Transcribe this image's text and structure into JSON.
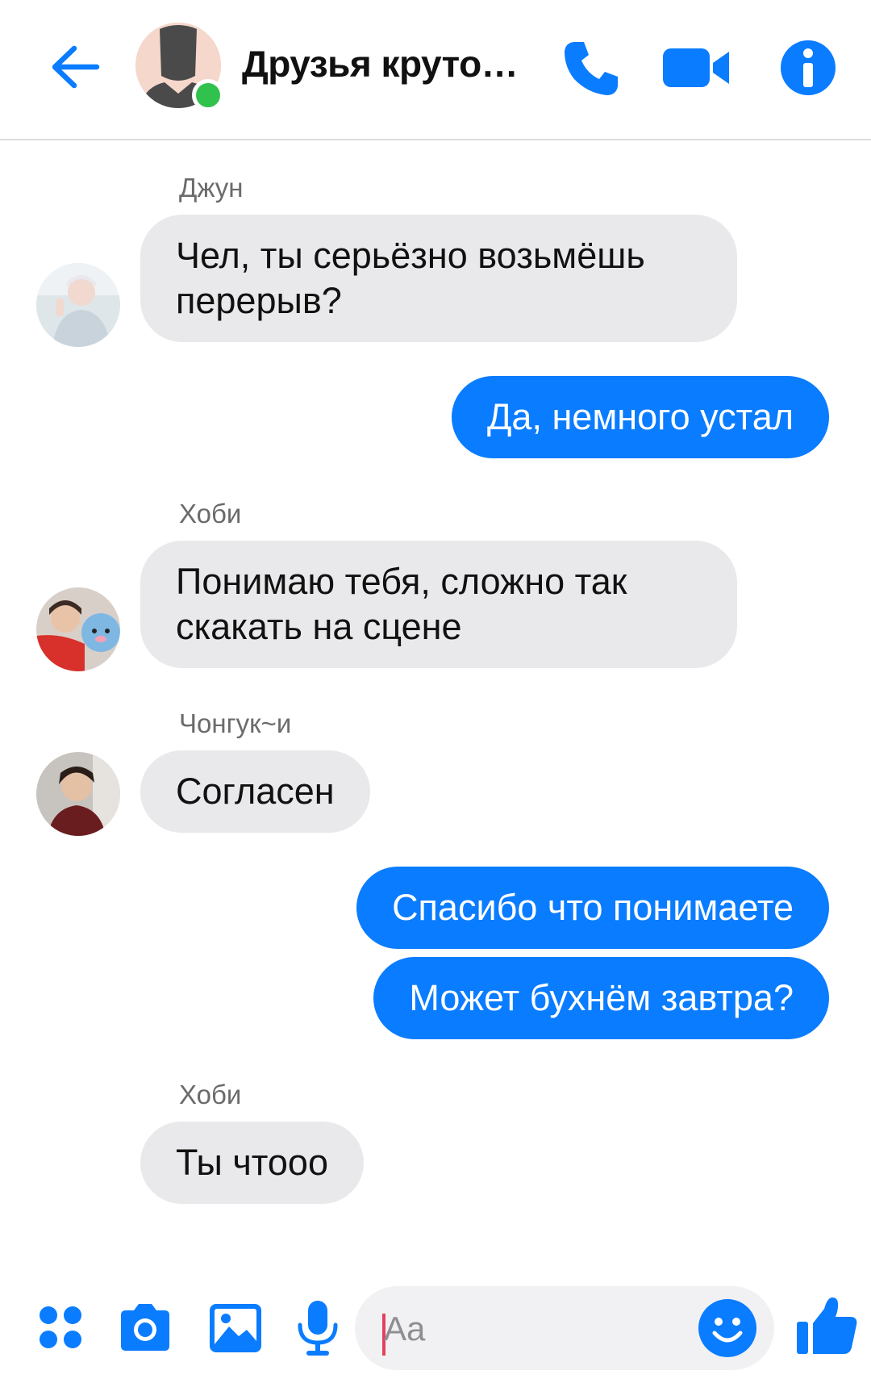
{
  "header": {
    "title": "Друзья круто…",
    "back_icon": "arrow-left-icon",
    "call_icon": "phone-icon",
    "video_icon": "video-camera-icon",
    "info_icon": "info-icon",
    "online_status": "online",
    "accent": "#0a7cff"
  },
  "messages": [
    {
      "sender": "Джун",
      "direction": "incoming",
      "text_lines": [
        "Чел, ты серьёзно возьмёшь",
        "перерыв?"
      ]
    },
    {
      "direction": "outgoing",
      "text": "Да, немного устал"
    },
    {
      "sender": "Хоби",
      "direction": "incoming",
      "text_lines": [
        "Понимаю тебя, сложно так",
        "скакать на сцене"
      ]
    },
    {
      "sender": "Чонгук~и",
      "direction": "incoming",
      "text": "Согласен"
    },
    {
      "direction": "outgoing",
      "text": "Спасибо что понимаете"
    },
    {
      "direction": "outgoing",
      "text": "Может бухнём завтра?"
    },
    {
      "sender": "Хоби",
      "direction": "incoming",
      "text": "Ты чтооо"
    }
  ],
  "composer": {
    "placeholder": "Aa",
    "icons": [
      "apps-grid-icon",
      "camera-icon",
      "image-icon",
      "microphone-icon",
      "emoji-icon",
      "thumbs-up-icon"
    ]
  },
  "colors": {
    "incoming_bubble": "#e9e9ec",
    "outgoing_bubble": "#0a7cff",
    "online_dot": "#31c24d"
  }
}
